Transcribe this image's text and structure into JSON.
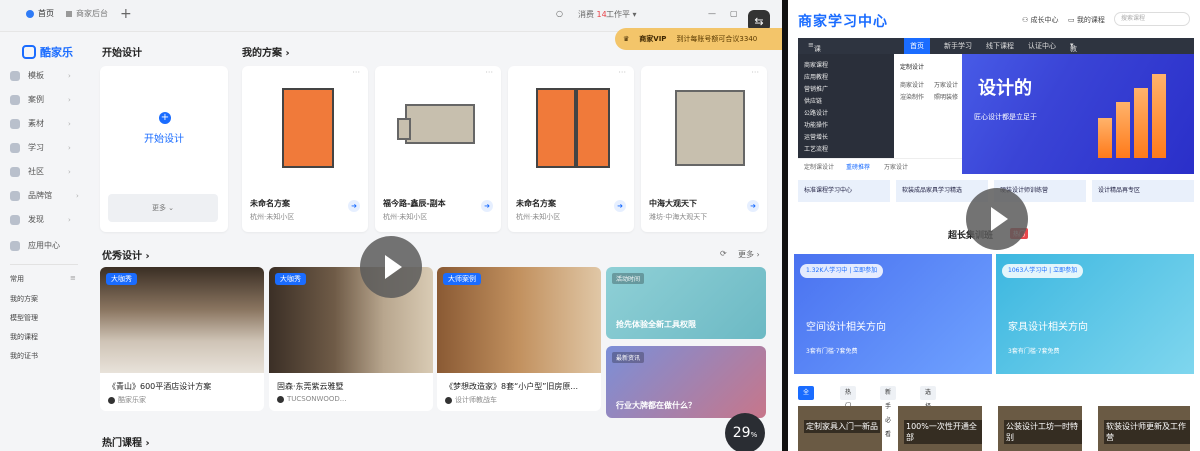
{
  "browser": {
    "tabs": [
      {
        "label": "首页",
        "active": true
      },
      {
        "label": "商家后台",
        "active": false
      }
    ],
    "new_tab": "+",
    "status_count": "消费",
    "status_num": "14",
    "workspace": "工作平",
    "vip_label": "商家VIP",
    "vip_note": "到计每账号额可合议3340"
  },
  "sidebar": {
    "app_name": "酷家乐",
    "items": [
      {
        "label": "模板"
      },
      {
        "label": "案例"
      },
      {
        "label": "素材"
      },
      {
        "label": "学习"
      },
      {
        "label": "社区"
      },
      {
        "label": "品牌馆"
      },
      {
        "label": "发现"
      },
      {
        "label": "应用中心"
      }
    ],
    "common_header": "常用",
    "common_items": [
      "我的方案",
      "模型管理",
      "我的课程",
      "我的证书"
    ]
  },
  "main": {
    "start_section_title": "开始设计",
    "start_label": "开始设计",
    "start_more": "更多",
    "plans_title": "我的方案",
    "plans": [
      {
        "name": "未命名方案",
        "location": "杭州·未知小区"
      },
      {
        "name": "福今路-鑫辰-副本",
        "location": "杭州·未知小区"
      },
      {
        "name": "未命名方案",
        "location": "杭州·未知小区"
      },
      {
        "name": "中海大观天下",
        "location": "潍坊·中海大观天下"
      }
    ],
    "excellent_title": "优秀设计",
    "refresh_label": "更多",
    "designs": [
      {
        "badge": "大咖秀",
        "title": "《青山》600平酒店设计方案",
        "author": "酷家乐家"
      },
      {
        "badge": "大咖秀",
        "title": "固森·东莞紫云雅墅",
        "author": "TUCSONWOOD..."
      },
      {
        "badge": "大师案例",
        "title": "《梦想改造家》8套“小户型”旧房原...",
        "author": "设计师教战车"
      }
    ],
    "promos": [
      {
        "tag": "活动时间",
        "text": "抢先体验全新工具权限"
      },
      {
        "tag": "最新资讯",
        "text": "行业大牌都在做什么？"
      }
    ],
    "hot_courses_title": "热门课程"
  },
  "overlay": {
    "zoom_value": "29",
    "zoom_unit": "%"
  },
  "right_panel": {
    "logo": "商家学习中心",
    "links": [
      "成长中心",
      "我的课程"
    ],
    "search_placeholder": "搜索课程",
    "nav": {
      "category": "课程分类",
      "items": [
        "首页",
        "新手学习",
        "线下课程",
        "认证中心",
        "教室中心"
      ]
    },
    "menu_items": [
      "商家课程",
      "应用教程",
      "营销推广",
      "供应链",
      "公路设计",
      "功能操作",
      "运营增长",
      "工艺流程"
    ],
    "menu_sub_title": "定制设计",
    "menu_sub_items": [
      "商家设计",
      "万家设计",
      "渲染制作",
      "照明装修"
    ],
    "menu_foot": [
      "定制课设计",
      "重磅推荐",
      "万家设计"
    ],
    "banner_title": "设计的",
    "banner_sub": "匠心设计都是立足于",
    "categories": [
      "标准课程学习中心",
      "软装成品家具学习精选",
      "硬装设计师训练营",
      "设计精品再专区"
    ],
    "growth_title": "超长集训班",
    "growth_badge": "热门",
    "cards": [
      {
        "pill": "1.32K人学习中 | 立即参加",
        "title": "空间设计相关方向",
        "sub": "3套有门槛·7套免费"
      },
      {
        "pill": "1063人学习中 | 立即参加",
        "title": "家具设计相关方向",
        "sub": "3套有门槛·7套免费"
      }
    ],
    "filters": [
      "全部项目",
      "热门推荐",
      "新手必看",
      "选择个人项目"
    ],
    "thumbs": [
      "定制家具入门一新品",
      "100%一次性开通全部",
      "公装设计工坊一时特别",
      "软装设计师更新及工作营"
    ]
  },
  "colors": {
    "brand": "#1a6cff",
    "vip": "#f3c56a",
    "hot": "#e8464b"
  }
}
